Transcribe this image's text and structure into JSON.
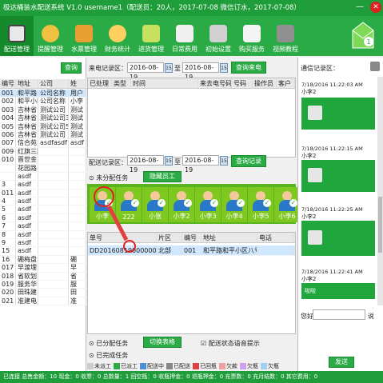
{
  "window": {
    "title": "极达桶装水配送系统 V1.0    username1（配送员：20人，2017-07-08   微信订水，2017-07-08）",
    "minimize": "—",
    "close": "✕"
  },
  "toolbar": {
    "items": [
      {
        "label": "配送管理",
        "color": "#e8e8e8"
      },
      {
        "label": "提醒管理",
        "color": "#f0c040"
      },
      {
        "label": "水票管理",
        "color": "#e8a030"
      },
      {
        "label": "财务统计",
        "color": "#ffd060"
      },
      {
        "label": "进货管理",
        "color": "#c8e060"
      },
      {
        "label": "日常费用",
        "color": "#f0f0f0"
      },
      {
        "label": "初始设置",
        "color": "#d0d0d0"
      },
      {
        "label": "购买服务",
        "color": "#f4f4f4"
      },
      {
        "label": "视频教程",
        "color": "#909090"
      }
    ],
    "badge": "1"
  },
  "left": {
    "query_button": "查询",
    "columns": [
      "编号",
      "地址",
      "公司",
      "姓"
    ],
    "rows": [
      [
        "001",
        "和平路",
        "公司名称",
        "用户"
      ],
      [
        "002",
        "和平小区",
        "公司名称",
        "小李"
      ],
      [
        "003",
        "吉林省",
        "测试公司",
        "测试"
      ],
      [
        "004",
        "吉林省",
        "测试公司3",
        "测试"
      ],
      [
        "005",
        "吉林省",
        "测试公司5",
        "测试"
      ],
      [
        "006",
        "吉林省",
        "测试公司",
        "测试"
      ],
      [
        "007",
        "信合苑",
        "asdfasdf",
        "asdf"
      ],
      [
        "009",
        "红旗三路",
        "",
        ""
      ],
      [
        "010",
        "晋世金",
        "",
        ""
      ],
      [
        "",
        "花园路",
        "",
        ""
      ],
      [
        "",
        "asdf",
        "",
        ""
      ],
      [
        "3",
        "asdf",
        "",
        ""
      ],
      [
        "011",
        "asdf",
        "",
        ""
      ],
      [
        "4",
        "asdf",
        "",
        ""
      ],
      [
        "5",
        "asdf",
        "",
        ""
      ],
      [
        "6",
        "asdf",
        "",
        ""
      ],
      [
        "7",
        "asdf",
        "",
        ""
      ],
      [
        "8",
        "asdf",
        "",
        ""
      ],
      [
        "9",
        "asdf",
        "",
        ""
      ],
      [
        "15",
        "asdf",
        "",
        ""
      ],
      [
        "16",
        "硼梅盘",
        "",
        "硼"
      ],
      [
        "017",
        "早渡埋",
        "",
        "早"
      ],
      [
        "018",
        "省软划",
        "",
        "省"
      ],
      [
        "019",
        "服务华",
        "",
        "服"
      ],
      [
        "020",
        "田珠建",
        "",
        "田"
      ],
      [
        "021",
        "准建电",
        "",
        "准"
      ]
    ]
  },
  "calls": {
    "label": "来电记录区：",
    "date_from": "2016-08-19",
    "date_to": "2016-08-19",
    "query_button": "查询来电",
    "columns": [
      "已处理",
      "类型",
      "时间",
      "来去电号码",
      "号码",
      "操作员",
      "客户"
    ]
  },
  "delivery": {
    "label": "配送记录区：",
    "date_from": "2016-08-19",
    "date_to": "2016-08-19",
    "query_button": "查询记录",
    "unassigned": "未分配任务",
    "hide_staff": "隐藏员工",
    "staff": [
      "小李",
      "222",
      "小张",
      "小李2",
      "小李3",
      "小李4",
      "小李5",
      "小李6"
    ],
    "columns": [
      "单号",
      "片区",
      "编号",
      "地址",
      "电话"
    ],
    "rows": [
      [
        "DD201608190000001",
        "北部",
        "001",
        "和平路和平小区八号楼",
        ""
      ]
    ],
    "assigned": "已分配任务",
    "switch_view": "切换表格",
    "voice_prompt": "配送状态语音提示",
    "completed": "已完成任务"
  },
  "legend": [
    {
      "label": "未派工",
      "color": "#cccccc"
    },
    {
      "label": "已派工",
      "color": "#2aab46"
    },
    {
      "label": "配送中",
      "color": "#4a90d9"
    },
    {
      "label": "已配送",
      "color": "#888888"
    },
    {
      "label": "已回瓶",
      "color": "#e04040"
    },
    {
      "label": "欠款",
      "color": "#f0a0a0"
    },
    {
      "label": "欠瓶",
      "color": "#d0a0f0"
    },
    {
      "label": "欠瓶",
      "color": "#a0d0f0"
    }
  ],
  "chat": {
    "label": "通信记录区：",
    "messages": [
      {
        "time": "7/18/2016 11:22:03 AM",
        "user": "小李2"
      },
      {
        "time": "7/18/2016 11:22:15 AM",
        "user": "小李2"
      },
      {
        "time": "7/18/2016 11:22:25 AM",
        "user": "小李2"
      },
      {
        "time": "7/18/2016 11:22:41 AM",
        "user": "小李2",
        "text": "啦啦"
      }
    ],
    "input_label": "您好",
    "input_suffix": "说",
    "send_button": "发送"
  },
  "status": {
    "text": "已连接     总售金额：10  现金：0  收票：0  总数量：1  回空瓶：0  收瓶押金：0  退瓶押金：0  充票数：0  充月结数：0  其它费用：0"
  }
}
